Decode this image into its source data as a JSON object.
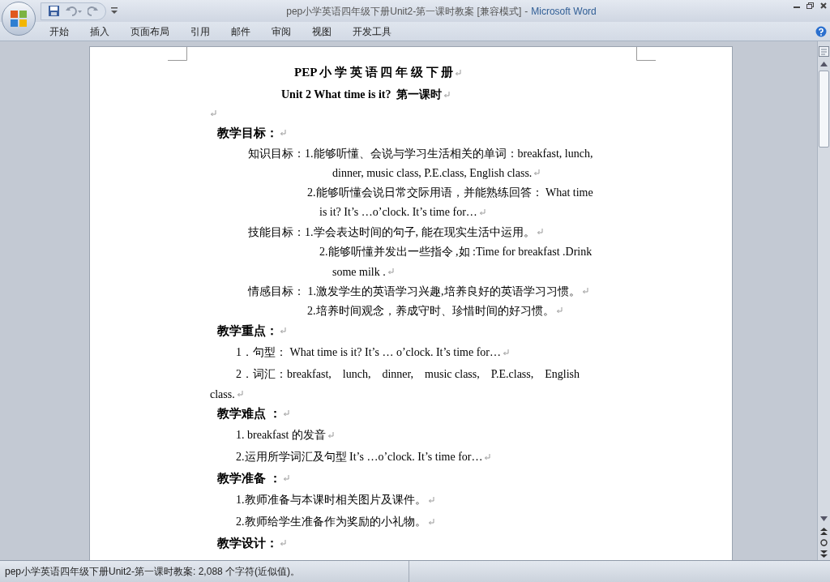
{
  "window": {
    "title": "pep小学英语四年级下册Unit2-第一课时教案 [兼容模式]",
    "separator": "-",
    "app": "Microsoft Word"
  },
  "ribbon_tabs": [
    {
      "label": "开始",
      "selected": false
    },
    {
      "label": "插入",
      "selected": false
    },
    {
      "label": "页面布局",
      "selected": false
    },
    {
      "label": "引用",
      "selected": false
    },
    {
      "label": "邮件",
      "selected": false
    },
    {
      "label": "审阅",
      "selected": false
    },
    {
      "label": "视图",
      "selected": false
    },
    {
      "label": "开发工具",
      "selected": false
    }
  ],
  "document": {
    "paragraphs": [
      {
        "kind": "title",
        "text": "PEP 小 学 英 语 四 年 级 下 册",
        "mark": true
      },
      {
        "kind": "subtitle",
        "text": "Unit 2 What time is it?  第一课时",
        "mark": true
      },
      {
        "kind": "blank",
        "mark": true
      },
      {
        "kind": "heading",
        "text": "教学目标：",
        "mark": true
      },
      {
        "kind": "goal",
        "label": "知识目标：",
        "text": "1.能够听懂、会说与学习生活相关的单词：breakfast, lunch,",
        "mark": false
      },
      {
        "kind": "deep",
        "text": "dinner, music class, P.E.class, English class.",
        "mark": true
      },
      {
        "kind": "cont",
        "text": "2.能够听懂会说日常交际用语，并能熟练回答： What time",
        "mark": false
      },
      {
        "kind": "mid",
        "text": "is it? It’s …o’clock. It’s time for…",
        "mark": true
      },
      {
        "kind": "goal",
        "label": "技能目标：",
        "text": "1.学会表达时间的句子, 能在现实生活中运用。",
        "mark": true
      },
      {
        "kind": "mid",
        "text": "2.能够听懂并发出一些指令 ,如 :Time for breakfast .Drink",
        "mark": false
      },
      {
        "kind": "deep",
        "text": "some milk .",
        "mark": true
      },
      {
        "kind": "goal",
        "label": "情感目标：",
        "text": " 1.激发学生的英语学习兴趣,培养良好的英语学习习惯。",
        "mark": true
      },
      {
        "kind": "cont",
        "text": "2.培养时间观念，养成守时、珍惜时间的好习惯。",
        "mark": true
      },
      {
        "kind": "heading",
        "text": "教学重点：",
        "mark": true
      },
      {
        "kind": "item",
        "text": "1．句型： What time is it? It’s … o’clock. It’s time for…",
        "mark": true
      },
      {
        "kind": "item",
        "text": "2．词汇：breakfast,　lunch,　dinner,　music class,　P.E.class,　English",
        "mark": false
      },
      {
        "kind": "wrap",
        "text": "class.",
        "mark": true
      },
      {
        "kind": "heading",
        "text": "教学难点 ：",
        "mark": true
      },
      {
        "kind": "item",
        "text": "1. breakfast 的发音",
        "mark": true
      },
      {
        "kind": "item",
        "text": "2.运用所学词汇及句型 It’s …o’clock. It’s time for…",
        "mark": true
      },
      {
        "kind": "heading",
        "text": "教学准备 ：",
        "mark": true
      },
      {
        "kind": "item",
        "text": "1.教师准备与本课时相关图片及课件。",
        "mark": true
      },
      {
        "kind": "item",
        "text": "2.教师给学生准备作为奖励的小礼物。",
        "mark": true
      },
      {
        "kind": "heading",
        "text": "教学设计：",
        "mark": true
      }
    ]
  },
  "status_bar": {
    "text": "pep小学英语四年级下册Unit2-第一课时教案: 2,088 个字符(近似值)。"
  }
}
